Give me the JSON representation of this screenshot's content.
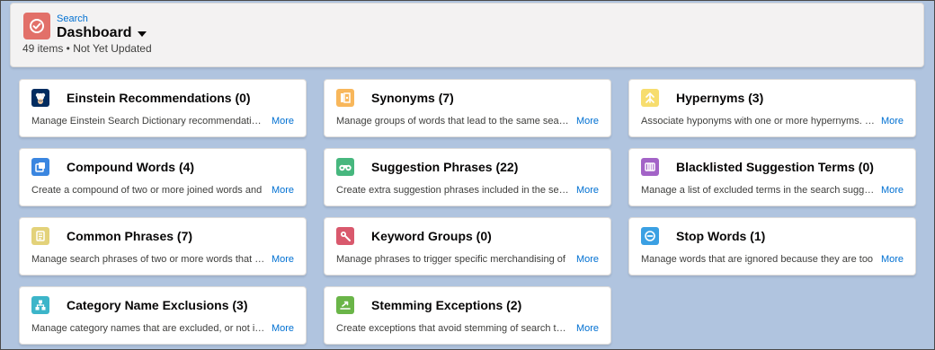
{
  "header": {
    "eyebrow": "Search",
    "title": "Dashboard",
    "subtitle": "49 items • Not Yet Updated",
    "icon": "search-dashboard-icon",
    "icon_color": "#e27069"
  },
  "cards": [
    {
      "title": "Einstein Recommendations (0)",
      "description": "Manage Einstein Search Dictionary recommendations",
      "more": "More",
      "icon": "einstein-icon",
      "icon_color": "#032d60"
    },
    {
      "title": "Synonyms (7)",
      "description": "Manage groups of words that lead to the same search results",
      "more": "More",
      "icon": "synonyms-icon",
      "icon_color": "#f8b75b"
    },
    {
      "title": "Hypernyms (3)",
      "description": "Associate hyponyms with one or more hypernyms. Hypernyms",
      "more": "More",
      "icon": "hypernyms-icon",
      "icon_color": "#f7dd6e"
    },
    {
      "title": "Compound Words (4)",
      "description": "Create a compound of two or more joined words and",
      "more": "More",
      "icon": "compound-words-icon",
      "icon_color": "#3a86e0"
    },
    {
      "title": "Suggestion Phrases (22)",
      "description": "Create extra suggestion phrases included in the search",
      "more": "More",
      "icon": "suggestion-phrases-icon",
      "icon_color": "#47b77e"
    },
    {
      "title": "Blacklisted Suggestion Terms (0)",
      "description": "Manage a list of excluded terms in the search suggestions",
      "more": "More",
      "icon": "blacklisted-terms-icon",
      "icon_color": "#a363c7"
    },
    {
      "title": "Common Phrases (7)",
      "description": "Manage search phrases of two or more words that are",
      "more": "More",
      "icon": "common-phrases-icon",
      "icon_color": "#e3d27a"
    },
    {
      "title": "Keyword Groups (0)",
      "description": "Manage phrases to trigger specific merchandising of",
      "more": "More",
      "icon": "keyword-groups-icon",
      "icon_color": "#d9596d"
    },
    {
      "title": "Stop Words (1)",
      "description": "Manage words that are ignored because they are too",
      "more": "More",
      "icon": "stop-words-icon",
      "icon_color": "#3ba0e3"
    },
    {
      "title": "Category Name Exclusions (3)",
      "description": "Manage category names that are excluded, or not included",
      "more": "More",
      "icon": "category-exclusions-icon",
      "icon_color": "#3cb5c9"
    },
    {
      "title": "Stemming Exceptions (2)",
      "description": "Create exceptions that avoid stemming of search terms",
      "more": "More",
      "icon": "stemming-exceptions-icon",
      "icon_color": "#6ab548"
    }
  ]
}
